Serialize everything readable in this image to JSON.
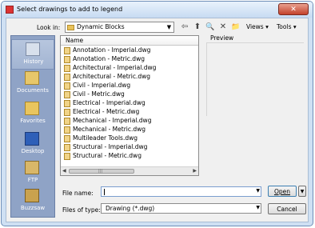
{
  "window": {
    "title": "Select drawings to add to legend",
    "close_symbol": "✕"
  },
  "lookin": {
    "label": "Look in:",
    "value": "Dynamic Blocks"
  },
  "toolbar": {
    "back_icon": "⇦",
    "up_icon": "⬆",
    "search_icon": "🔍",
    "delete_icon": "✕",
    "new_folder_icon": "📁",
    "views_label": "Views",
    "tools_label": "Tools"
  },
  "places": [
    {
      "label": "History",
      "icon": "history-icon"
    },
    {
      "label": "Documents",
      "icon": "documents-icon"
    },
    {
      "label": "Favorites",
      "icon": "favorites-icon"
    },
    {
      "label": "Desktop",
      "icon": "desktop-icon"
    },
    {
      "label": "FTP",
      "icon": "ftp-icon"
    },
    {
      "label": "Buzzsaw",
      "icon": "buzzsaw-icon"
    }
  ],
  "filelist": {
    "column_header": "Name",
    "files": [
      "Annotation - Imperial.dwg",
      "Annotation - Metric.dwg",
      "Architectural - Imperial.dwg",
      "Architectural - Metric.dwg",
      "Civil - Imperial.dwg",
      "Civil - Metric.dwg",
      "Electrical - Imperial.dwg",
      "Electrical - Metric.dwg",
      "Mechanical - Imperial.dwg",
      "Mechanical - Metric.dwg",
      "Multileader Tools.dwg",
      "Structural - Imperial.dwg",
      "Structural - Metric.dwg"
    ]
  },
  "preview": {
    "label": "Preview"
  },
  "filename": {
    "label": "File name:",
    "value": ""
  },
  "filetype": {
    "label": "Files of type:",
    "value": "Drawing (*.dwg)"
  },
  "buttons": {
    "open": "Open",
    "cancel": "Cancel"
  },
  "colors": {
    "title_bar": "#c7dbf2",
    "places_bg": "#8fa3c6",
    "close_button": "#c3412b",
    "focus_border": "#3c7fb1"
  }
}
